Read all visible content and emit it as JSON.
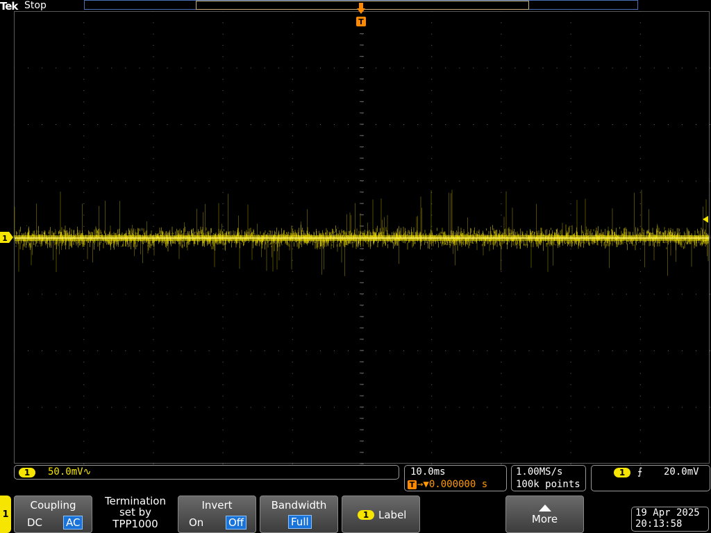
{
  "header": {
    "brand": "Tek",
    "acq_state": "Stop"
  },
  "markers": {
    "trigger": "T",
    "channel": "1"
  },
  "channel_readout": {
    "badge": "1",
    "scale": "50.0mV",
    "coupling_symbol": "∿"
  },
  "time_readout": {
    "timebase": "10.0ms",
    "trigger_icon": "T",
    "position": "→▼0.000000 s"
  },
  "acq_readout": {
    "sample_rate": "1.00MS/s",
    "record_length": "100k points"
  },
  "trigger_readout": {
    "badge": "1",
    "slope_symbol": "⨍",
    "level": "20.0mV"
  },
  "menu": {
    "channel_tab": "1",
    "coupling": {
      "title": "Coupling",
      "opt_a": "DC",
      "opt_b": "AC",
      "selected": "AC"
    },
    "termination": {
      "line1": "Termination",
      "line2": "set by",
      "line3": "TPP1000"
    },
    "invert": {
      "title": "Invert",
      "opt_a": "On",
      "opt_b": "Off",
      "selected": "Off"
    },
    "bandwidth": {
      "title": "Bandwidth",
      "value": "Full"
    },
    "label": {
      "badge": "1",
      "text": "Label"
    },
    "more": {
      "text": "More"
    }
  },
  "datetime": {
    "date": "19 Apr 2025",
    "time": "20:13:58"
  },
  "colors": {
    "trace": "#f5e500",
    "trigger": "#ff8a00",
    "select": "#1a73d9"
  }
}
